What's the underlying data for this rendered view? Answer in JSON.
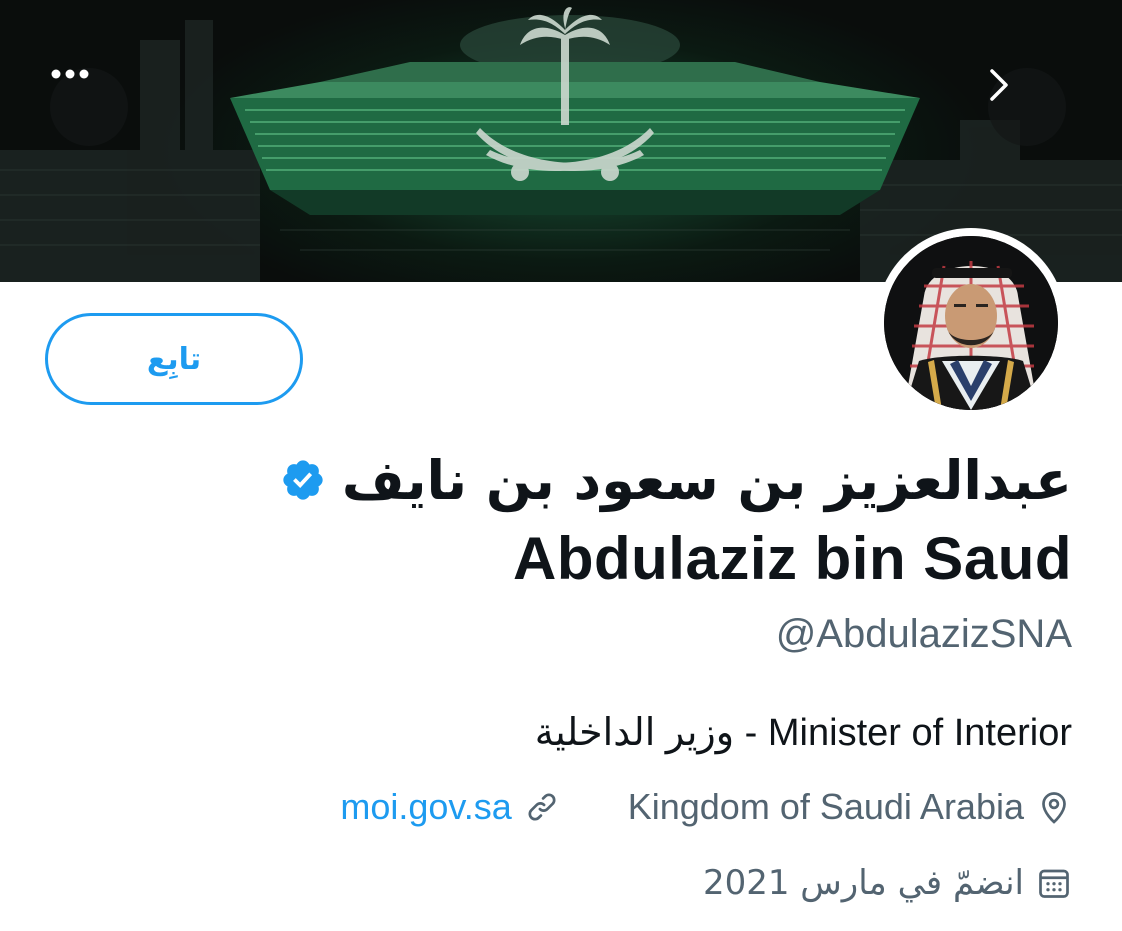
{
  "header": {
    "more_icon": "more-horizontal-icon",
    "next_icon": "chevron-right-icon"
  },
  "profile": {
    "follow_label": "تابِع",
    "name_arabic": "عبدالعزيز بن سعود بن نايف",
    "name_english": "Abdulaziz bin Saud",
    "handle": "@AbdulazizSNA",
    "verified": true,
    "bio": "وزير الداخلية - Minister of Interior",
    "location": "Kingdom of Saudi Arabia",
    "website": "moi.gov.sa",
    "joined": "انضمّ في مارس 2021"
  },
  "colors": {
    "accent": "#1d9bf0",
    "secondary_text": "#536471",
    "primary_text": "#0f1419"
  }
}
